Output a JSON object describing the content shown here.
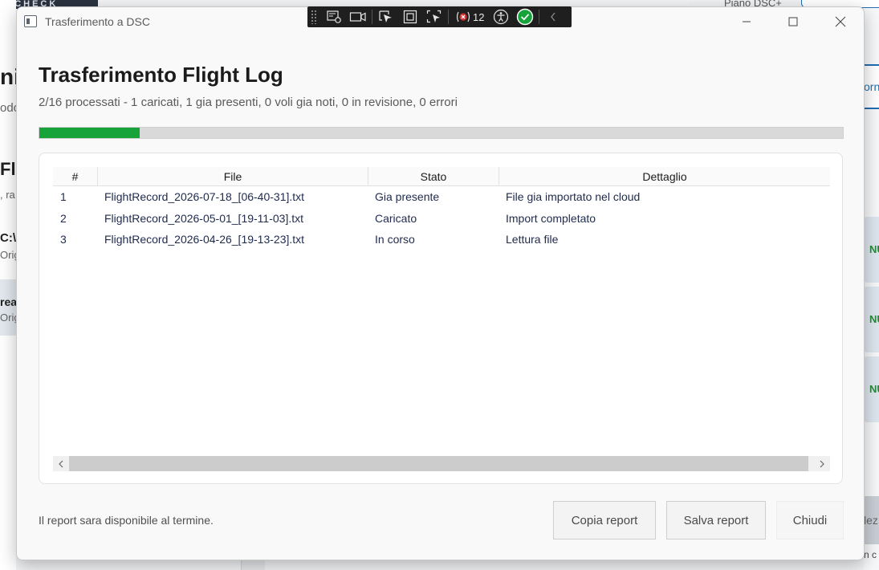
{
  "background": {
    "logo_fragment": "Y CHECK",
    "left_title_fragment": "niz",
    "left_sub_fragment": "odo",
    "left_h2_fragment": "Flig",
    "left_small_fragment": ", ra",
    "left_path_fragment": "C:\\",
    "left_orig_fragment_1": "Orig",
    "left_rea_fragment": "rea",
    "left_orig_fragment_2": "Orig",
    "piano_fragment": "Piano DSC+",
    "tab_fragment": "orn",
    "card_badge": "NU",
    "select_button_fragment": "lez",
    "bottom_text_fragment": "n c"
  },
  "window": {
    "title": "Trasferimento a DSC",
    "icon": "app-window-icon"
  },
  "debug_toolbar": {
    "error_count": "12",
    "icons": [
      "live-visual-tree-icon",
      "video-icon",
      "select-element-icon",
      "display-layout-icon",
      "track-focus-icon",
      "binding-failures-icon",
      "accessibility-icon",
      "check-icon",
      "collapse-chevron-icon"
    ]
  },
  "dialog": {
    "heading": "Trasferimento Flight Log",
    "summary": "2/16 processati - 1 caricati, 1 gia presenti, 0 voli gia noti, 0 in revisione, 0 errori",
    "progress": 0.125,
    "table": {
      "columns": [
        "#",
        "File",
        "Stato",
        "Dettaglio"
      ],
      "rows": [
        {
          "num": "1",
          "file": "FlightRecord_2026-07-18_[06-40-31].txt",
          "stato": "Gia presente",
          "dettaglio": "File gia importato nel cloud"
        },
        {
          "num": "2",
          "file": "FlightRecord_2026-05-01_[19-11-03].txt",
          "stato": "Caricato",
          "dettaglio": "Import completato"
        },
        {
          "num": "3",
          "file": "FlightRecord_2026-04-26_[19-13-23].txt",
          "stato": "In corso",
          "dettaglio": "Lettura file"
        }
      ]
    },
    "footer_note": "Il report sara disponibile al termine.",
    "buttons": {
      "copy": "Copia report",
      "save": "Salva report",
      "close": "Chiudi"
    }
  },
  "colors": {
    "progress_fill": "#16a33a",
    "toolbar_bg": "#1f1f1f",
    "accent": "#1f6fb2"
  }
}
